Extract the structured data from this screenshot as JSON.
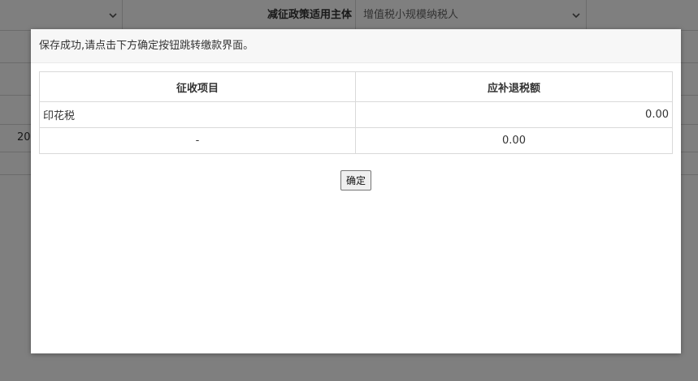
{
  "background_form": {
    "policy_label": "减征政策适用主体",
    "policy_select_value": "增值税小规模纳税人",
    "row_prefix": "20"
  },
  "dialog": {
    "message": "保存成功,请点击下方确定按钮跳转缴款界面。",
    "table": {
      "headers": [
        "征收项目",
        "应补退税额"
      ],
      "rows": [
        {
          "item": "印花税",
          "amount": "0.00"
        },
        {
          "item": "-",
          "amount": "0.00"
        }
      ]
    },
    "ok_label": "确定"
  },
  "colors": {
    "overlay": "#000000",
    "dialog_header_bg": "#f7f7f7",
    "border": "#d9d9d9"
  },
  "icons": [
    "chevron-down-icon"
  ]
}
